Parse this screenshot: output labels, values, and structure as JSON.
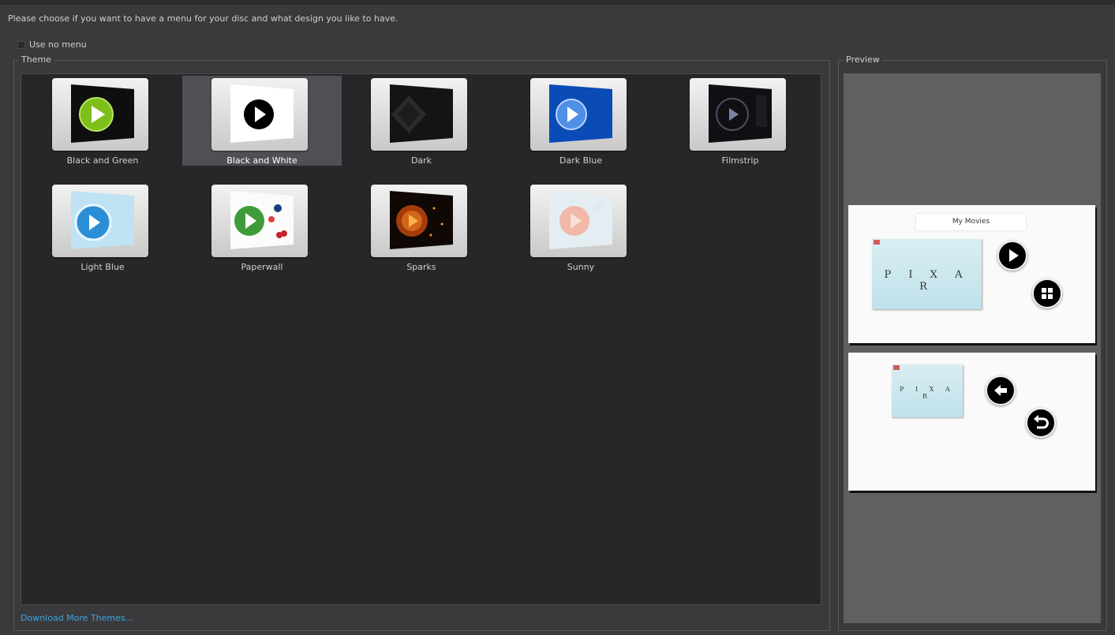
{
  "instruction": "Please choose if you want to have a menu for your disc and what design you like to have.",
  "use_no_menu": {
    "label": "Use no menu",
    "checked": false
  },
  "theme_group_label": "Theme",
  "preview_group_label": "Preview",
  "themes": [
    {
      "name": "Black and Green",
      "icon": "theme-black-and-green-thumbnail",
      "selected": false
    },
    {
      "name": "Black and White",
      "icon": "theme-black-and-white-thumbnail",
      "selected": true
    },
    {
      "name": "Dark",
      "icon": "theme-dark-thumbnail",
      "selected": false
    },
    {
      "name": "Dark Blue",
      "icon": "theme-dark-blue-thumbnail",
      "selected": false
    },
    {
      "name": "Filmstrip",
      "icon": "theme-filmstrip-thumbnail",
      "selected": false
    },
    {
      "name": "Light Blue",
      "icon": "theme-light-blue-thumbnail",
      "selected": false
    },
    {
      "name": "Paperwall",
      "icon": "theme-paperwall-thumbnail",
      "selected": false
    },
    {
      "name": "Sparks",
      "icon": "theme-sparks-thumbnail",
      "selected": false
    },
    {
      "name": "Sunny",
      "icon": "theme-sunny-thumbnail",
      "selected": false
    }
  ],
  "download_link": "Download More Themes...",
  "preview": {
    "main_menu": {
      "title": "My Movies",
      "video_title": "P I X A R",
      "buttons": [
        "play-icon",
        "chapters-grid-icon"
      ]
    },
    "chapter_menu": {
      "video_title": "P I X A R",
      "buttons": [
        "back-arrow-icon",
        "return-icon"
      ]
    }
  },
  "colors": {
    "link": "#3ba3e0",
    "selection": "#4f5053",
    "list_bg": "#262729",
    "window_bg": "#3a3a3c"
  }
}
